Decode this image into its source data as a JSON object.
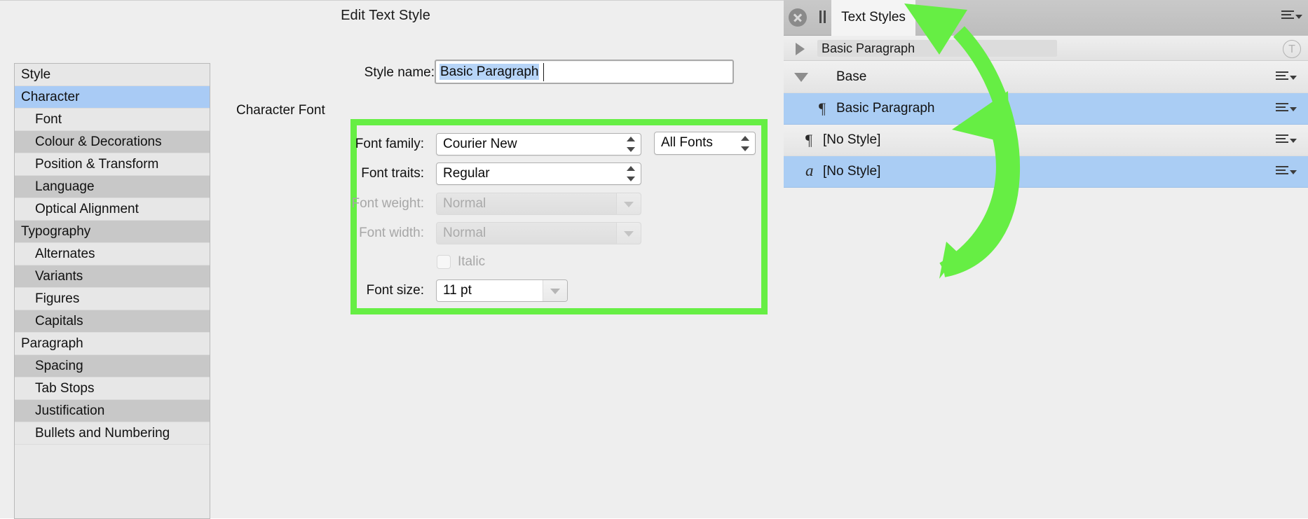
{
  "dialog": {
    "title": "Edit Text Style",
    "style_name_label": "Style name:",
    "style_name_value": "Basic Paragraph",
    "character_font_heading": "Character Font",
    "sidebar": [
      {
        "label": "Style",
        "level": "group",
        "state": "light"
      },
      {
        "label": "Character",
        "level": "group",
        "state": "selected"
      },
      {
        "label": "Font",
        "level": "child",
        "state": "light"
      },
      {
        "label": "Colour & Decorations",
        "level": "child",
        "state": "dark"
      },
      {
        "label": "Position & Transform",
        "level": "child",
        "state": "light"
      },
      {
        "label": "Language",
        "level": "child",
        "state": "dark"
      },
      {
        "label": "Optical Alignment",
        "level": "child",
        "state": "light"
      },
      {
        "label": "Typography",
        "level": "group",
        "state": "dark"
      },
      {
        "label": "Alternates",
        "level": "child",
        "state": "light"
      },
      {
        "label": "Variants",
        "level": "child",
        "state": "dark"
      },
      {
        "label": "Figures",
        "level": "child",
        "state": "light"
      },
      {
        "label": "Capitals",
        "level": "child",
        "state": "dark"
      },
      {
        "label": "Paragraph",
        "level": "group",
        "state": "light"
      },
      {
        "label": "Spacing",
        "level": "child",
        "state": "dark"
      },
      {
        "label": "Tab Stops",
        "level": "child",
        "state": "light"
      },
      {
        "label": "Justification",
        "level": "child",
        "state": "dark"
      },
      {
        "label": "Bullets and Numbering",
        "level": "child",
        "state": "light"
      }
    ],
    "fields": {
      "font_family": {
        "label": "Font family:",
        "value": "Courier New",
        "enabled": true
      },
      "font_scope": {
        "label": "",
        "value": "All Fonts",
        "enabled": true
      },
      "font_traits": {
        "label": "Font traits:",
        "value": "Regular",
        "enabled": true
      },
      "font_weight": {
        "label": "Font weight:",
        "value": "Normal",
        "enabled": false
      },
      "font_width": {
        "label": "Font width:",
        "value": "Normal",
        "enabled": false
      },
      "italic": {
        "label": "Italic",
        "checked": false,
        "enabled": false
      },
      "font_size": {
        "label": "Font size:",
        "value": "11 pt",
        "enabled": true
      }
    }
  },
  "panel": {
    "tab_label": "Text Styles",
    "search_value": "Basic Paragraph",
    "text_badge": "T",
    "rows": [
      {
        "label": "Base",
        "icon": "",
        "selected": false,
        "indent": 0
      },
      {
        "label": "Basic Paragraph",
        "icon": "pilcrow",
        "selected": true,
        "indent": 1
      },
      {
        "label": "[No Style]",
        "icon": "pilcrow",
        "selected": false,
        "indent": 0
      },
      {
        "label": "[No Style]",
        "icon": "a-glyph",
        "selected": true,
        "indent": 0
      }
    ]
  },
  "colors": {
    "highlight_green": "#66ee44",
    "selection_blue": "#aacdf4",
    "sidebar_selected": "#a9cbf5",
    "text_selection": "#b6d4f7"
  },
  "icons": {
    "close": "close-icon",
    "pause": "pause-icon",
    "panel_menu": "panel-menu-icon",
    "disclosure_collapsed": "chevron-right-icon",
    "disclosure_expanded": "chevron-down-icon"
  }
}
